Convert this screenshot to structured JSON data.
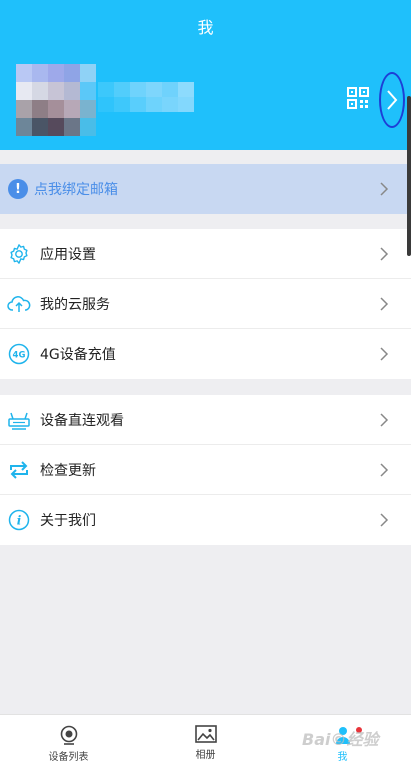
{
  "header": {
    "title": "我",
    "avatar_icon": "blurred-avatar",
    "qr_icon": "qrcode-icon",
    "arrow_icon": "chevron-right-icon"
  },
  "bind_email": {
    "label": "点我绑定邮箱",
    "icon": "warning-circle-icon",
    "warn_glyph": "!"
  },
  "menu_group_1": [
    {
      "label": "应用设置",
      "icon": "gear-icon"
    },
    {
      "label": "我的云服务",
      "icon": "cloud-upload-icon"
    },
    {
      "label": "4G设备充值",
      "icon": "4g-icon",
      "icon_text": "4G"
    }
  ],
  "menu_group_2": [
    {
      "label": "设备直连观看",
      "icon": "router-icon"
    },
    {
      "label": "检查更新",
      "icon": "refresh-icon"
    },
    {
      "label": "关于我们",
      "icon": "info-icon",
      "icon_text": "i"
    }
  ],
  "tabbar": [
    {
      "label": "设备列表",
      "icon": "camera-icon",
      "active": false
    },
    {
      "label": "相册",
      "icon": "photo-icon",
      "active": false
    },
    {
      "label": "我",
      "icon": "person-icon",
      "active": true,
      "badge": true
    }
  ],
  "watermark": {
    "text": "Bai©经验"
  },
  "colors": {
    "accent": "#1fc0fb",
    "bind_bar_bg": "#c8d8f2",
    "bind_text": "#4a8ee8",
    "highlight_ring": "#1d3fd6",
    "badge": "#e8343a"
  }
}
